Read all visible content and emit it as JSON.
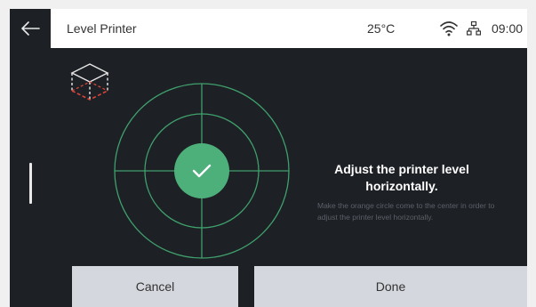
{
  "header": {
    "title": "Level Printer",
    "temperature": "25°C",
    "time": "09:00"
  },
  "icons": {
    "back": "arrow-left-icon",
    "wifi": "wifi-icon",
    "network": "network-icon",
    "cube": "cube-level-icon",
    "check": "checkmark-icon"
  },
  "colors": {
    "background": "#1d2025",
    "header_bg": "#ffffff",
    "target_lines": "#3fa06c",
    "bubble": "#4db07a",
    "button_bg": "#d4d7dd",
    "cube_accent": "#d9453a"
  },
  "level": {
    "status": "level"
  },
  "instructions": {
    "title": "Adjust the printer level horizontally.",
    "body": "Make the orange circle come to the center in order to adjust the printer level horizontally."
  },
  "buttons": {
    "cancel": "Cancel",
    "done": "Done"
  }
}
